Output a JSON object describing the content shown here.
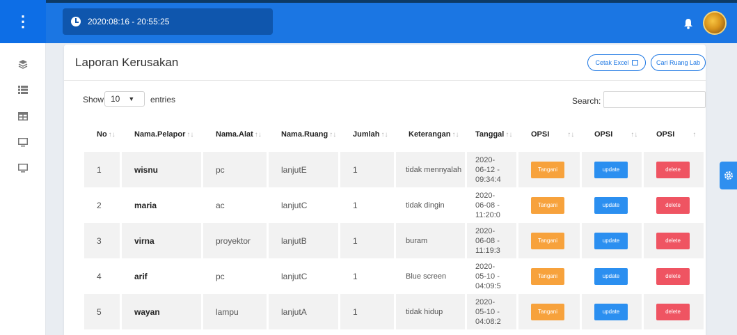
{
  "topbar": {
    "datetime": "2020:08:16 - 20:55:25"
  },
  "header": {
    "title": "Laporan Kerusakan",
    "btn_excel": "Cetak Excel",
    "btn_cari": "Cari Ruang Lab"
  },
  "controls": {
    "show": "Show",
    "entries_value": "10",
    "entries": "entries",
    "search": "Search:"
  },
  "table": {
    "columns": [
      "No",
      "Nama.Pelapor",
      "Nama.Alat",
      "Nama.Ruang",
      "Jumlah",
      "Keterangan",
      "Tanggal",
      "OPSI",
      "OPSI",
      "OPSI"
    ],
    "rows": [
      {
        "no": "1",
        "pelapor": "wisnu",
        "alat": "pc",
        "ruang": "lanjutE",
        "jumlah": "1",
        "ket": "tidak mennyalah",
        "tgl1": "2020-",
        "tgl2": "06-12 -",
        "tgl3": "09:34:4"
      },
      {
        "no": "2",
        "pelapor": "maria",
        "alat": "ac",
        "ruang": "lanjutC",
        "jumlah": "1",
        "ket": "tidak dingin",
        "tgl1": "2020-",
        "tgl2": "06-08 -",
        "tgl3": "11:20:0"
      },
      {
        "no": "3",
        "pelapor": "virna",
        "alat": "proyektor",
        "ruang": "lanjutB",
        "jumlah": "1",
        "ket": "buram",
        "tgl1": "2020-",
        "tgl2": "06-08 -",
        "tgl3": "11:19:3"
      },
      {
        "no": "4",
        "pelapor": "arif",
        "alat": "pc",
        "ruang": "lanjutC",
        "jumlah": "1",
        "ket": "Blue screen",
        "tgl1": "2020-",
        "tgl2": "05-10 -",
        "tgl3": "04:09:5"
      },
      {
        "no": "5",
        "pelapor": "wayan",
        "alat": "lampu",
        "ruang": "lanjutA",
        "jumlah": "1",
        "ket": "tidak hidup",
        "tgl1": "2020-",
        "tgl2": "05-10 -",
        "tgl3": "04:08:2"
      }
    ],
    "btn_tangani": "Tangani",
    "btn_update": "update",
    "btn_delete": "delete"
  },
  "icons": {
    "menu": "menu-dots-icon",
    "sidebar": [
      "layers-icon",
      "list-icon",
      "table-icon",
      "monitor-icon",
      "monitor-icon"
    ],
    "bell": "bell-icon",
    "gear": "gear-icon"
  },
  "colors": {
    "primary": "#1b76e3",
    "orange": "#f7a23c",
    "blue": "#2b8ff0",
    "red": "#ef5462"
  }
}
